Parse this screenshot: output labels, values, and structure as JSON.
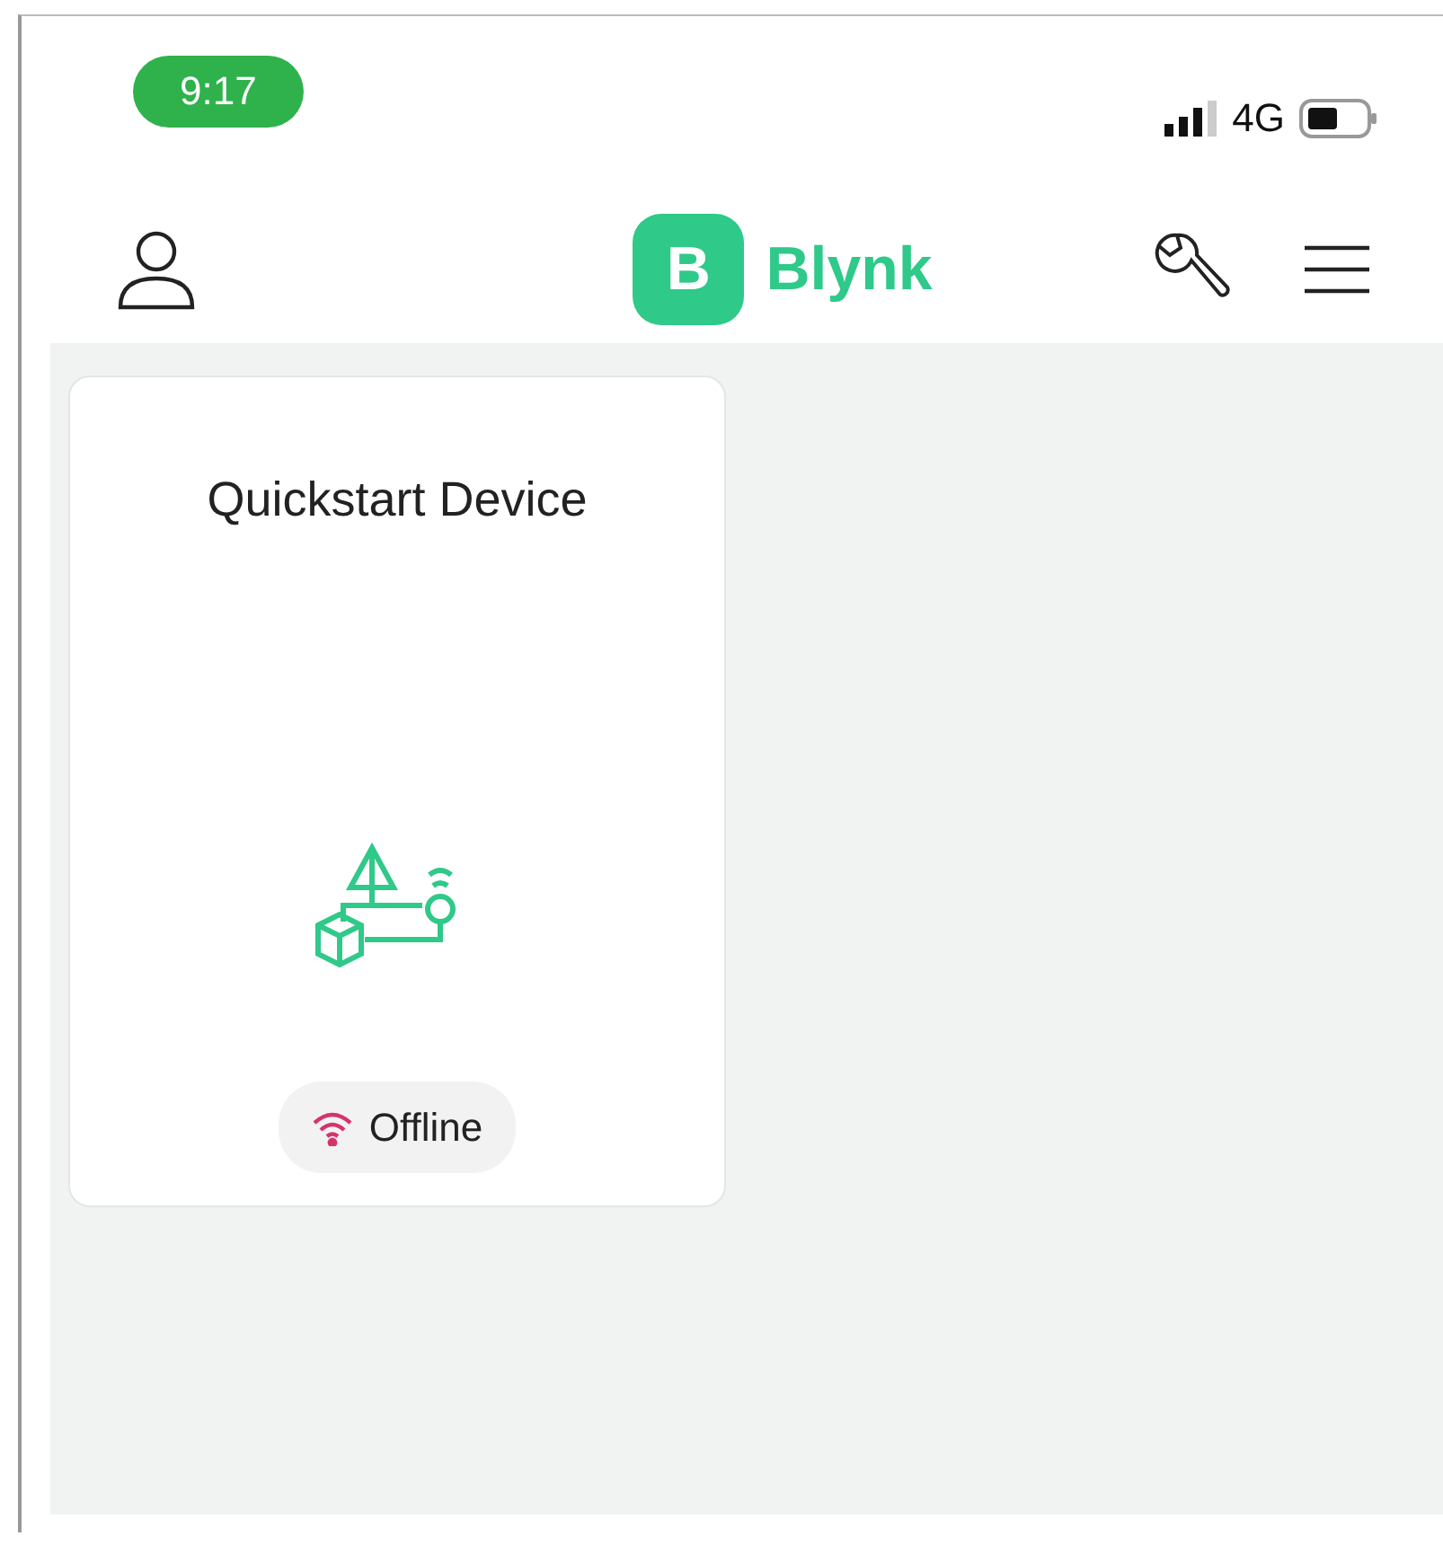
{
  "status_bar": {
    "time": "9:17",
    "network": "4G"
  },
  "header": {
    "logo_letter": "B",
    "app_name": "Blynk"
  },
  "devices": [
    {
      "name": "Quickstart Device",
      "status": "Offline",
      "online": false
    }
  ]
}
